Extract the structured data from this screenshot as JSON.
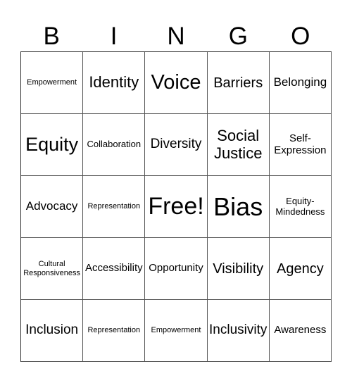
{
  "header": {
    "letters": [
      "B",
      "I",
      "N",
      "G",
      "O"
    ]
  },
  "grid": {
    "rows": [
      [
        "Empowerment",
        "Identity",
        "Voice",
        "Barriers",
        "Belonging"
      ],
      [
        "Equity",
        "Collaboration",
        "Diversity",
        "Social Justice",
        "Self-Expression"
      ],
      [
        "Advocacy",
        "Representation",
        "Free!",
        "Bias",
        "Equity-Mindedness"
      ],
      [
        "Cultural Responsiveness",
        "Accessibility",
        "Opportunity",
        "Visibility",
        "Agency"
      ],
      [
        "Inclusion",
        "Representation",
        "Empowerment",
        "Inclusivity",
        "Awareness"
      ]
    ],
    "free_space": "Free!"
  }
}
